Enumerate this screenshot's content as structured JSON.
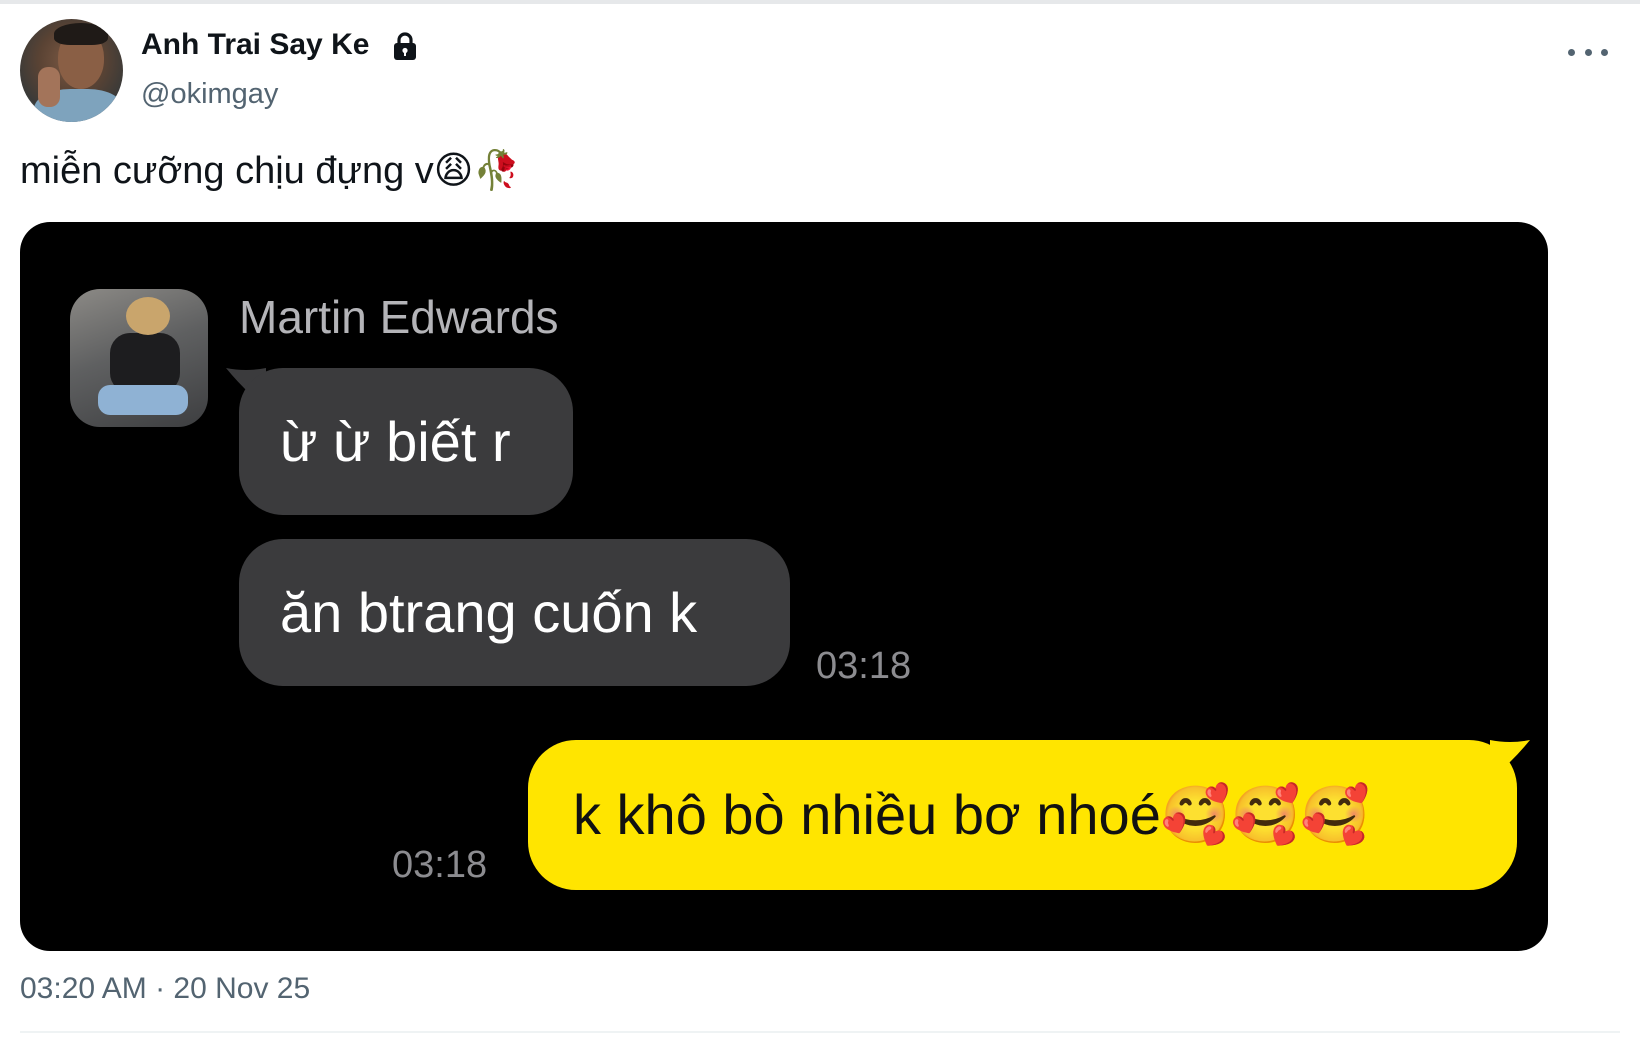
{
  "tweet": {
    "author": {
      "display_name": "Anh Trai Say Ke",
      "handle": "@okimgay",
      "protected_icon": "lock-icon",
      "avatar": "profile-photo"
    },
    "text": "miễn cưỡng chịu đựng v😩🥀",
    "more_icon": "more-horizontal-icon",
    "timestamp": "03:20 AM · 20 Nov 25"
  },
  "media": {
    "type": "chat-screenshot",
    "contact": {
      "name": "Martin Edwards",
      "avatar": "contact-photo"
    },
    "messages": [
      {
        "direction": "incoming",
        "text": "ừ ừ biết r"
      },
      {
        "direction": "incoming",
        "text": "ăn btrang cuốn k",
        "time": "03:18"
      },
      {
        "direction": "outgoing",
        "text": "k khô bò nhiều bơ nhoé🥰🥰🥰",
        "time": "03:18"
      }
    ],
    "colors": {
      "background": "#000000",
      "incoming_bubble": "#3b3b3d",
      "outgoing_bubble": "#ffe500"
    }
  }
}
